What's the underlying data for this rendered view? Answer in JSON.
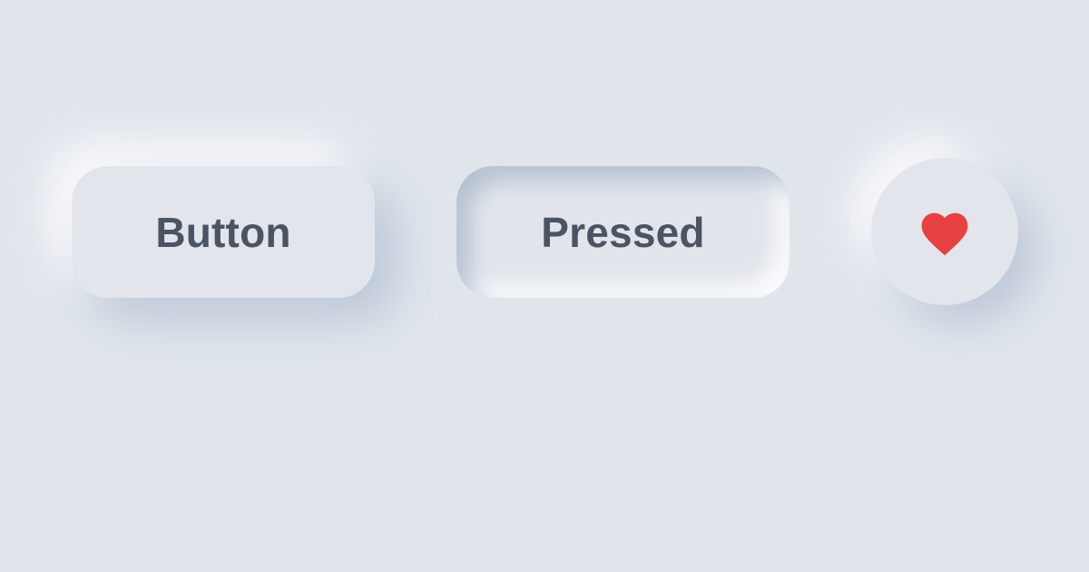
{
  "buttons": {
    "raised_label": "Button",
    "pressed_label": "Pressed",
    "icon": "heart-icon"
  },
  "colors": {
    "background": "#e0e5ec",
    "text": "#4a5462",
    "heart": "#e84141"
  }
}
